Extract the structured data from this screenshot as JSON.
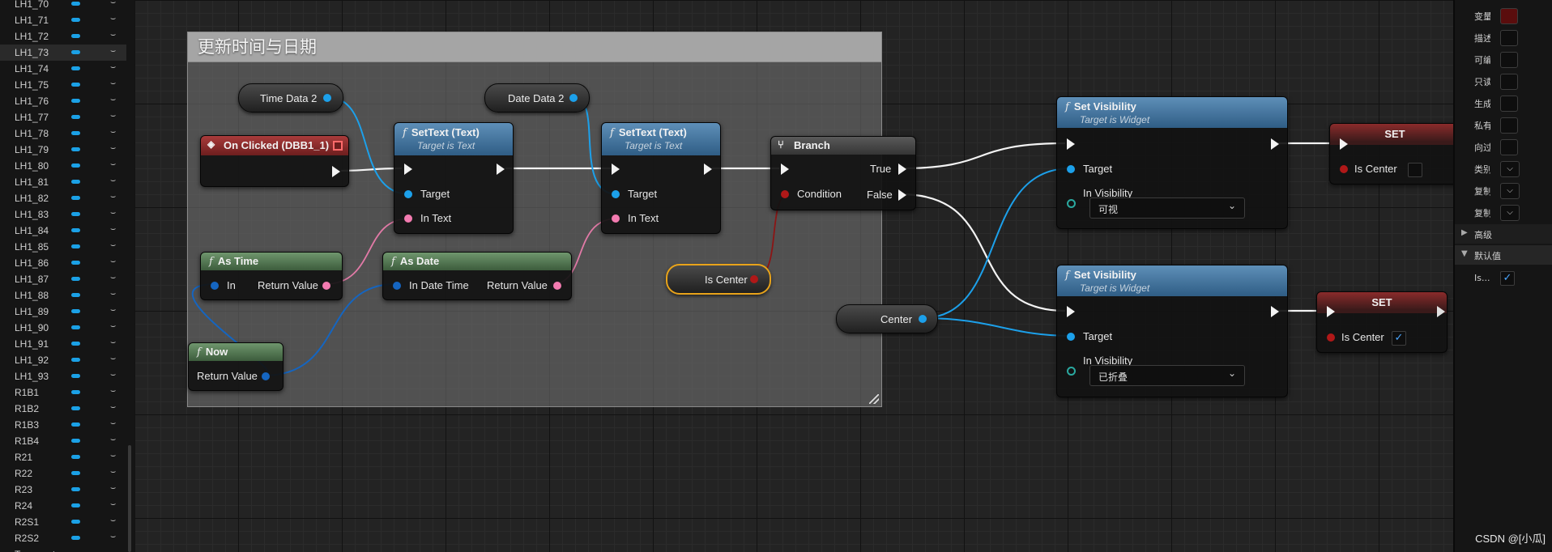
{
  "variables": [
    {
      "label": "LH1_70"
    },
    {
      "label": "LH1_71"
    },
    {
      "label": "LH1_72"
    },
    {
      "label": "LH1_73",
      "selected": true
    },
    {
      "label": "LH1_74"
    },
    {
      "label": "LH1_75"
    },
    {
      "label": "LH1_76"
    },
    {
      "label": "LH1_77"
    },
    {
      "label": "LH1_78"
    },
    {
      "label": "LH1_79"
    },
    {
      "label": "LH1_80"
    },
    {
      "label": "LH1_81"
    },
    {
      "label": "LH1_82"
    },
    {
      "label": "LH1_83"
    },
    {
      "label": "LH1_84"
    },
    {
      "label": "LH1_85"
    },
    {
      "label": "LH1_86"
    },
    {
      "label": "LH1_87"
    },
    {
      "label": "LH1_88"
    },
    {
      "label": "LH1_89"
    },
    {
      "label": "LH1_90"
    },
    {
      "label": "LH1_91"
    },
    {
      "label": "LH1_92"
    },
    {
      "label": "LH1_93"
    },
    {
      "label": "R1B1"
    },
    {
      "label": "R1B2"
    },
    {
      "label": "R1B3"
    },
    {
      "label": "R1B4"
    },
    {
      "label": "R21"
    },
    {
      "label": "R22"
    },
    {
      "label": "R23"
    },
    {
      "label": "R24"
    },
    {
      "label": "R2S1"
    },
    {
      "label": "R2S2"
    },
    {
      "label": "Temperatu"
    }
  ],
  "comment": {
    "title": "更新时间与日期"
  },
  "nodes": {
    "time_data": {
      "label": "Time Data 2"
    },
    "date_data": {
      "label": "Date Data 2"
    },
    "on_clicked": {
      "title": "On Clicked (DBB1_1)"
    },
    "settext1": {
      "title": "SetText (Text)",
      "subtitle": "Target is Text",
      "target": "Target",
      "in_text": "In Text"
    },
    "settext2": {
      "title": "SetText (Text)",
      "subtitle": "Target is Text",
      "target": "Target",
      "in_text": "In Text"
    },
    "branch": {
      "title": "Branch",
      "true": "True",
      "false": "False",
      "condition": "Condition"
    },
    "as_time": {
      "title": "As Time",
      "in": "In",
      "ret": "Return Value"
    },
    "as_date": {
      "title": "As Date",
      "in": "In Date Time",
      "ret": "Return Value"
    },
    "now": {
      "title": "Now",
      "ret": "Return Value"
    },
    "is_center": {
      "label": "Is Center"
    },
    "center": {
      "label": "Center"
    },
    "setvis1": {
      "title": "Set Visibility",
      "subtitle": "Target is Widget",
      "target": "Target",
      "in_vis": "In Visibility",
      "value": "可视"
    },
    "setvis2": {
      "title": "Set Visibility",
      "subtitle": "Target is Widget",
      "target": "Target",
      "in_vis": "In Visibility",
      "value": "已折叠"
    },
    "set1": {
      "title": "SET",
      "pin": "Is Center",
      "checked": false
    },
    "set2": {
      "title": "SET",
      "pin": "Is Center",
      "checked": true
    }
  },
  "details": {
    "rows": [
      {
        "label": "变量"
      },
      {
        "label": "描述"
      },
      {
        "label": "可编"
      },
      {
        "label": "只读"
      },
      {
        "label": "生成"
      },
      {
        "label": "私有"
      },
      {
        "label": "向过"
      },
      {
        "label": "类别"
      },
      {
        "label": "复制"
      },
      {
        "label": "复制"
      }
    ],
    "advanced": "高级",
    "defaults": "默认值",
    "default_label": "Is...",
    "checkmark": "✓",
    "caret": "⌵"
  },
  "watermark": "CSDN @[小瓜]",
  "colors": {
    "exec": "#f3f3f3",
    "object": "#1ca0ea",
    "text": "#f37bb0",
    "bool": "#b01818",
    "datetime": "#1565c0",
    "selection": "#e8a31a"
  }
}
